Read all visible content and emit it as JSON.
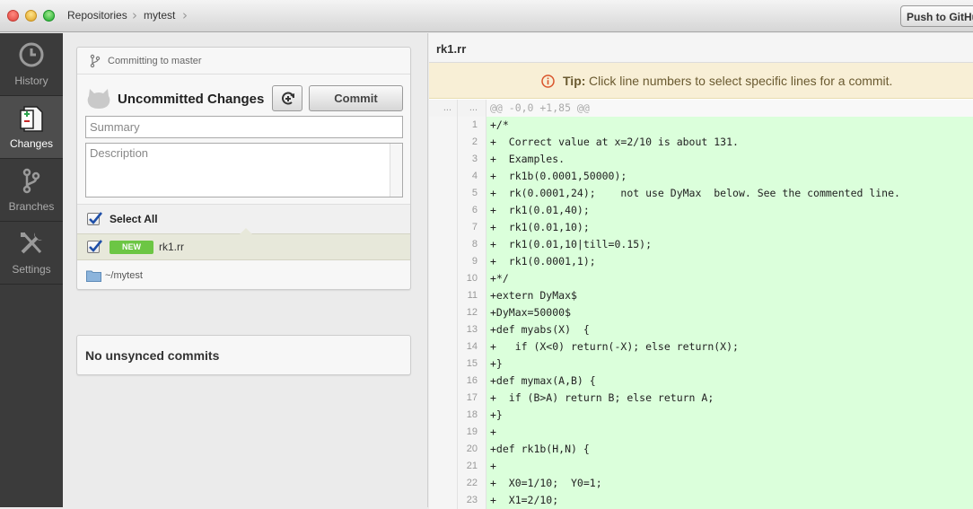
{
  "titlebar": {
    "breadcrumb": [
      "Repositories",
      "mytest"
    ],
    "push_button": "Push to GitHub"
  },
  "sidebar": {
    "items": [
      {
        "label": "History",
        "icon": "clock-icon"
      },
      {
        "label": "Changes",
        "icon": "changes-icon"
      },
      {
        "label": "Branches",
        "icon": "branch-icon"
      },
      {
        "label": "Settings",
        "icon": "tools-icon"
      }
    ],
    "active": "Changes"
  },
  "commit_panel": {
    "committing_to": "Committing to master",
    "title": "Uncommitted Changes",
    "commit_button": "Commit",
    "summary_placeholder": "Summary",
    "description_placeholder": "Description",
    "select_all": "Select All",
    "files": [
      {
        "badge": "NEW",
        "name": "rk1.rr",
        "checked": true
      }
    ],
    "path": "~/mytest"
  },
  "unsynced": {
    "label": "No unsynced commits"
  },
  "diff": {
    "file": "rk1.rr",
    "tip_bold": "Tip:",
    "tip_text": "Click line numbers to select specific lines for a commit.",
    "hunk": {
      "old": "...",
      "new": "...",
      "header": "@@ -0,0 +1,85 @@"
    },
    "lines": [
      {
        "n": "1",
        "text": "+/*"
      },
      {
        "n": "2",
        "text": "+  Correct value at x=2/10 is about 131."
      },
      {
        "n": "3",
        "text": "+  Examples."
      },
      {
        "n": "4",
        "text": "+  rk1b(0.0001,50000);"
      },
      {
        "n": "5",
        "text": "+  rk(0.0001,24);    not use DyMax  below. See the commented line."
      },
      {
        "n": "6",
        "text": "+  rk1(0.01,40);"
      },
      {
        "n": "7",
        "text": "+  rk1(0.01,10);"
      },
      {
        "n": "8",
        "text": "+  rk1(0.01,10|till=0.15);"
      },
      {
        "n": "9",
        "text": "+  rk1(0.0001,1);"
      },
      {
        "n": "10",
        "text": "+*/"
      },
      {
        "n": "11",
        "text": "+extern DyMax$"
      },
      {
        "n": "12",
        "text": "+DyMax=50000$"
      },
      {
        "n": "13",
        "text": "+def myabs(X)  {"
      },
      {
        "n": "14",
        "text": "+   if (X<0) return(-X); else return(X);"
      },
      {
        "n": "15",
        "text": "+}"
      },
      {
        "n": "16",
        "text": "+def mymax(A,B) {"
      },
      {
        "n": "17",
        "text": "+  if (B>A) return B; else return A;"
      },
      {
        "n": "18",
        "text": "+}"
      },
      {
        "n": "19",
        "text": "+"
      },
      {
        "n": "20",
        "text": "+def rk1b(H,N) {"
      },
      {
        "n": "21",
        "text": "+"
      },
      {
        "n": "22",
        "text": "+  X0=1/10;  Y0=1;"
      },
      {
        "n": "23",
        "text": "+  X1=2/10;"
      }
    ]
  },
  "colors": {
    "added_bg": "#dbffdb",
    "new_badge": "#6cc644",
    "tip_bg": "#f8efd6",
    "tip_icon": "#d9542b",
    "sidebar_bg": "#3b3b3b"
  }
}
